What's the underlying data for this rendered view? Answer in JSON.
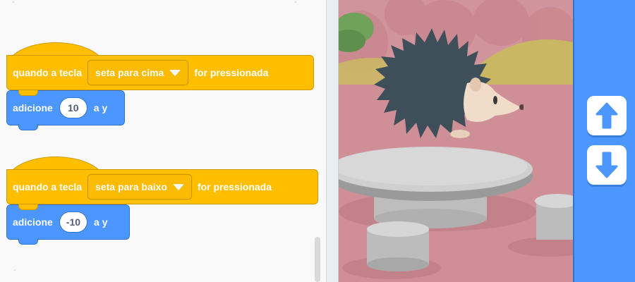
{
  "code_blocks": [
    {
      "event": {
        "prefix": "quando a tecla",
        "key_selected": "seta para cima",
        "suffix": "for pressionada"
      },
      "action": {
        "verb": "adicione",
        "value": "10",
        "target": "a y"
      }
    },
    {
      "event": {
        "prefix": "quando a tecla",
        "key_selected": "seta para baixo",
        "suffix": "for pressionada"
      },
      "action": {
        "verb": "adicione",
        "value": "-10",
        "target": "a y"
      }
    }
  ],
  "stage": {
    "sprite": "hedgehog",
    "backdrop": "park with stone table and stools"
  },
  "controls": [
    {
      "icon": "arrow-up-icon"
    },
    {
      "icon": "arrow-down-icon"
    }
  ],
  "colors": {
    "events": "#ffbf00",
    "motion": "#4c97ff",
    "controls_panel": "#4c97ff",
    "stage_bg": "#d2949c"
  }
}
